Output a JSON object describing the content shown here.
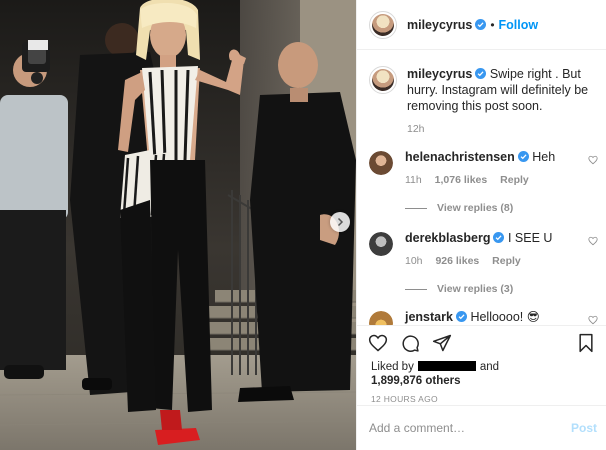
{
  "colors": {
    "accent": "#0095f6",
    "verified": "#3897f0",
    "muted": "#8e8e8e",
    "post_disabled": "#b2dffc"
  },
  "header": {
    "username": "mileycyrus",
    "separator": "•",
    "follow_label": "Follow"
  },
  "caption": {
    "username": "mileycyrus",
    "text": "Swipe right . But hurry. Instagram will definitely be removing this post soon.",
    "time": "12h"
  },
  "comments": [
    {
      "username": "helenachristensen",
      "text": "Heh",
      "time": "11h",
      "likes": "1,076 likes",
      "reply_label": "Reply",
      "view_replies": "View replies (8)"
    },
    {
      "username": "derekblasberg",
      "text": "I SEE U",
      "time": "10h",
      "likes": "926 likes",
      "reply_label": "Reply",
      "view_replies": "View replies (3)"
    },
    {
      "username": "jenstark",
      "text": "Helloooo! 😎"
    }
  ],
  "likes": {
    "prefix": "Liked by",
    "connector": "and",
    "count": "1,899,876 others"
  },
  "post_age": "12 HOURS AGO",
  "comment_input": {
    "placeholder": "Add a comment…",
    "post_label": "Post"
  },
  "icons": {
    "like": "heart-icon",
    "comment": "comment-icon",
    "share": "share-icon",
    "save": "bookmark-icon",
    "next": "chevron-right-icon",
    "verified": "verified-badge-icon"
  }
}
